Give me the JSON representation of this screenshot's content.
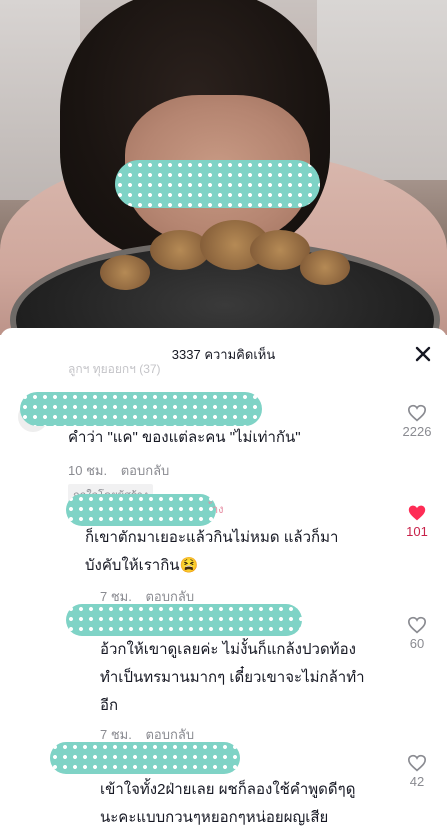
{
  "sheet": {
    "title": "3337 ความคิดเห็น",
    "close_icon": "close-icon"
  },
  "comments": [
    {
      "partial_top": "ลูกฯ ทุยอยกฯ (37)",
      "text": "คำว่า \"แค\" ของแต่ละคน \"ไม่เท่ากัน\"",
      "time": "10 ชม.",
      "reply": "ตอบกลับ",
      "badge": "ถูกใจโดยผู้สร้าง",
      "likes": "2226",
      "liked": false
    },
    {
      "username_tail": "้าง",
      "text_lines": [
        "ก็เขาตักมาเยอะแล้วกินไม่หมด แล้วก็มา",
        "บังคับให้เรากิน😫"
      ],
      "time": "7 ชม.",
      "reply": "ตอบกลับ",
      "likes": "101",
      "liked": true
    },
    {
      "text_lines": [
        "อ้วกให้เขาดูเลยค่ะ ไม่งั้นก็แกล้งปวดท้อง",
        "ทำเป็นทรมานมากๆ เดี๋ยวเขาจะไม่กล้าทำ",
        "อีก"
      ],
      "time": "7 ชม.",
      "reply": "ตอบกลับ",
      "likes": "60",
      "liked": false
    },
    {
      "text_lines": [
        "เข้าใจทั้ง2ฝ่ายเลย ผชก็ลองใช้คำพูดดีๆดู",
        "นะคะแบบกวนๆหยอกๆหน่อยผญเสีย"
      ],
      "likes": "42",
      "liked": false
    }
  ],
  "colors": {
    "like_red": "#fe2c55",
    "gray_text": "#8a8b91",
    "blur_teal": "#7fd3c6"
  }
}
